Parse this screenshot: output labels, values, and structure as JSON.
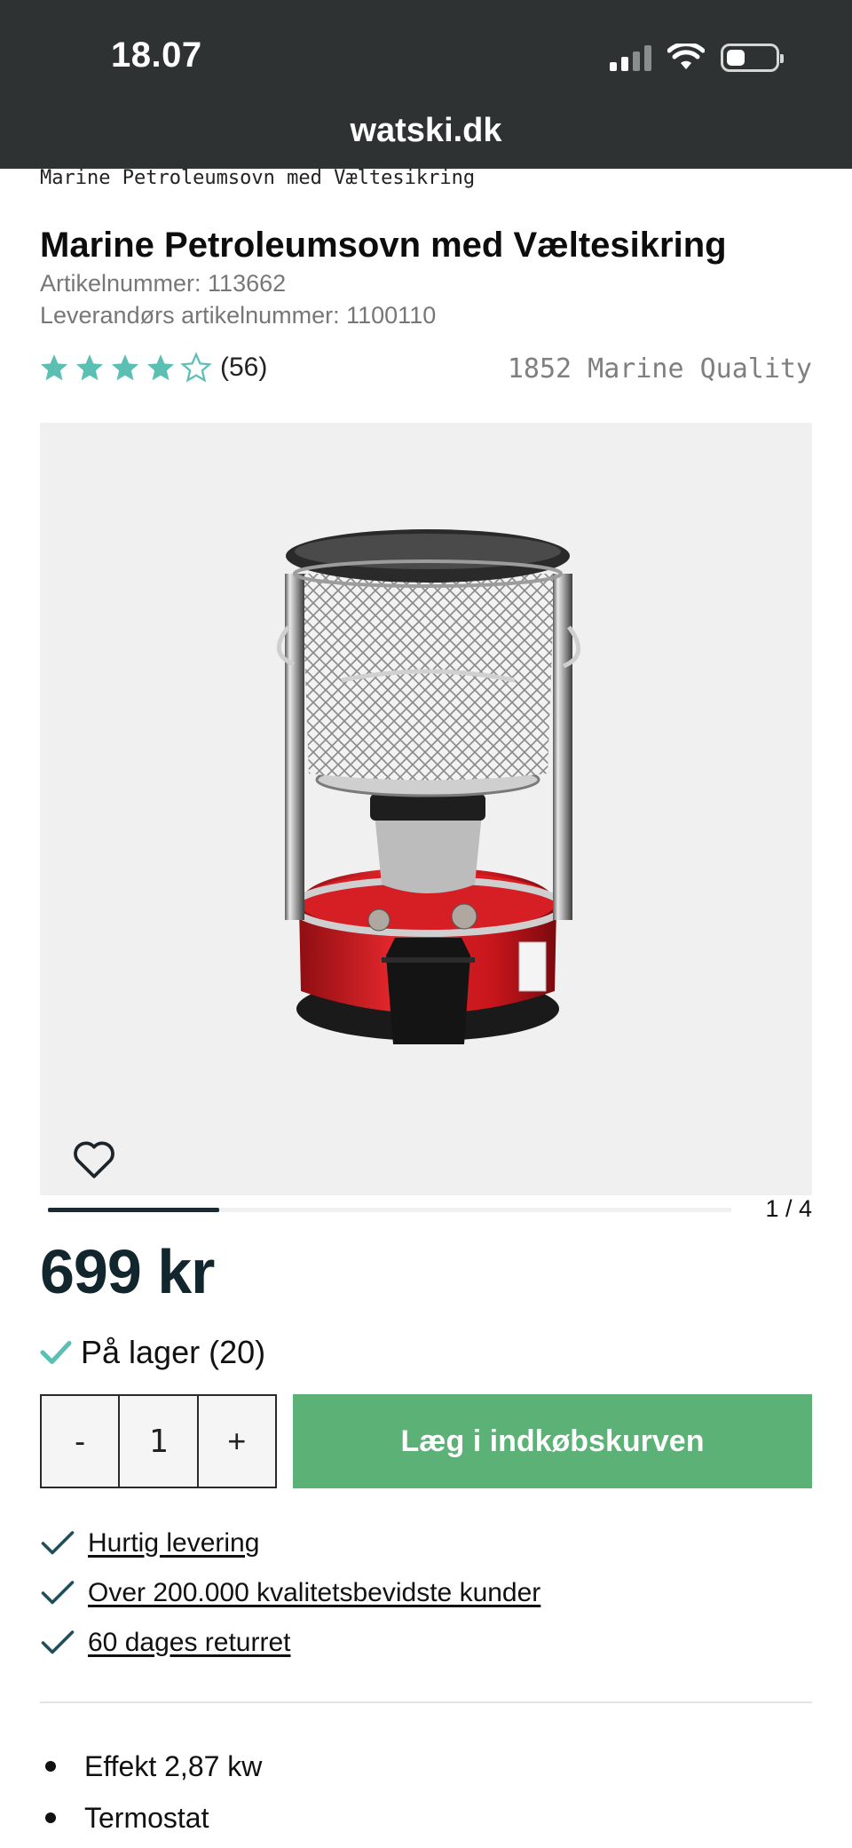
{
  "status_bar": {
    "time": "18.07"
  },
  "browser": {
    "url": "watski.dk"
  },
  "breadcrumb": "Marine Petroleumsovn med Væltesikring",
  "product": {
    "title": "Marine Petroleumsovn med Væltesikring",
    "article_number": "Artikelnummer: 113662",
    "supplier_number": "Leverandørs artikelnummer: 1100110",
    "rating": {
      "stars": 4,
      "max": 5,
      "count": "(56)"
    },
    "brand": "1852 Marine Quality",
    "gallery": {
      "pager": "1 / 4",
      "current": 1,
      "total": 4
    },
    "price": "699 kr",
    "stock": "På lager (20)",
    "quantity": {
      "minus": "-",
      "value": "1",
      "plus": "+"
    },
    "add_to_cart": "Læg i indkøbskurven"
  },
  "usps": [
    {
      "label": "Hurtig levering"
    },
    {
      "label": "Over 200.000 kvalitetsbevidste kunder"
    },
    {
      "label": "60 dages returret"
    }
  ],
  "features": [
    {
      "label": "Effekt 2,87 kw"
    },
    {
      "label": "Termostat"
    }
  ],
  "colors": {
    "accent": "#5cb176",
    "star": "#5bbfb4",
    "price": "#12262d",
    "topbar": "#2f3233"
  }
}
